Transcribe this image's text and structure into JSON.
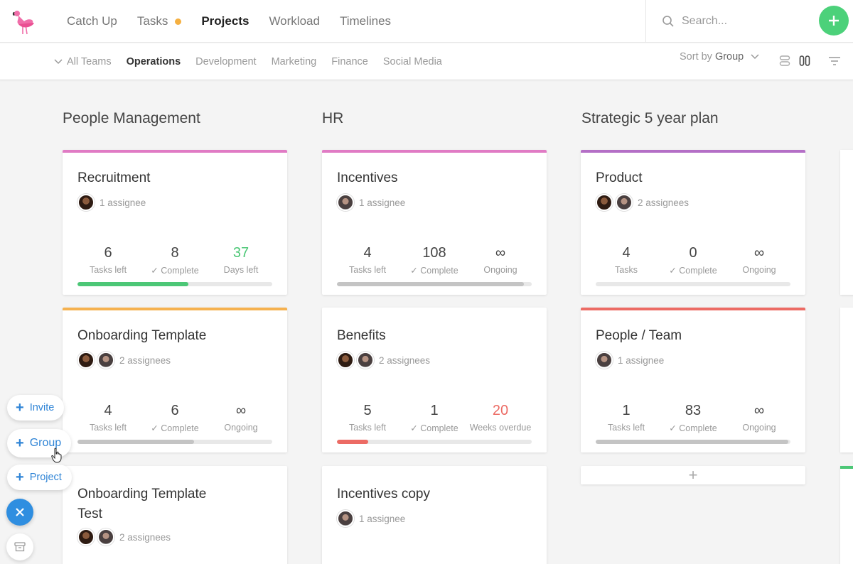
{
  "nav": {
    "items": [
      "Catch Up",
      "Tasks",
      "Projects",
      "Workload",
      "Timelines"
    ],
    "active": "Projects"
  },
  "search": {
    "placeholder": "Search..."
  },
  "subnav": {
    "teams": [
      "All Teams",
      "Operations",
      "Development",
      "Marketing",
      "Finance",
      "Social Media"
    ],
    "active": "Operations",
    "sort_label": "Sort by",
    "sort_value": "Group"
  },
  "columns": [
    {
      "title": "People Management",
      "cards": [
        {
          "title": "Recruitment",
          "color": "#e07bc4",
          "assignees": "1 assignee",
          "stats": [
            {
              "num": "6",
              "label": "Tasks left"
            },
            {
              "num": "8",
              "label": "✓ Complete"
            },
            {
              "num": "37",
              "label": "Days left",
              "color": "#4cc776"
            }
          ],
          "progress": 0.57,
          "progress_color": "#4cc776"
        },
        {
          "title": "Onboarding Template",
          "color": "#f5b14f",
          "assignees": "2 assignees",
          "stats": [
            {
              "num": "4",
              "label": "Tasks left"
            },
            {
              "num": "6",
              "label": "✓ Complete"
            },
            {
              "num": "∞",
              "label": "Ongoing"
            }
          ],
          "progress": 0.6,
          "progress_color": "#c4c4c4"
        },
        {
          "title_line1": "Onboarding Template",
          "title_line2": "Test",
          "assignees": "2 assignees"
        }
      ]
    },
    {
      "title": "HR",
      "cards": [
        {
          "title": "Incentives",
          "color": "#e07bc4",
          "assignees": "1 assignee",
          "stats": [
            {
              "num": "4",
              "label": "Tasks left"
            },
            {
              "num": "108",
              "label": "✓ Complete"
            },
            {
              "num": "∞",
              "label": "Ongoing"
            }
          ],
          "progress": 0.96,
          "progress_color": "#c4c4c4"
        },
        {
          "title": "Benefits",
          "assignees": "2 assignees",
          "stats": [
            {
              "num": "5",
              "label": "Tasks left"
            },
            {
              "num": "1",
              "label": "✓ Complete"
            },
            {
              "num": "20",
              "label": "Weeks overdue",
              "color": "#ec6b64"
            }
          ],
          "progress": 0.16,
          "progress_color": "#ec6b64"
        },
        {
          "title": "Incentives copy",
          "assignees": "1 assignee"
        }
      ]
    },
    {
      "title": "Strategic 5 year plan",
      "cards": [
        {
          "title": "Product",
          "color": "#b46fc6",
          "assignees": "2 assignees",
          "stats": [
            {
              "num": "4",
              "label": "Tasks"
            },
            {
              "num": "0",
              "label": "✓ Complete"
            },
            {
              "num": "∞",
              "label": "Ongoing"
            }
          ],
          "progress": 0,
          "progress_color": "#c4c4c4"
        },
        {
          "title": "People / Team",
          "color": "#ec6b64",
          "assignees": "1 assignee",
          "stats": [
            {
              "num": "1",
              "label": "Tasks left"
            },
            {
              "num": "83",
              "label": "✓ Complete"
            },
            {
              "num": "∞",
              "label": "Ongoing"
            }
          ],
          "progress": 0.99,
          "progress_color": "#c4c4c4"
        }
      ],
      "add_label": "+"
    }
  ],
  "fab": {
    "invite": "Invite",
    "group": "Group",
    "project": "Project"
  },
  "colors": {
    "accent_green": "#4cd17a",
    "accent_blue": "#2f8ee0"
  }
}
